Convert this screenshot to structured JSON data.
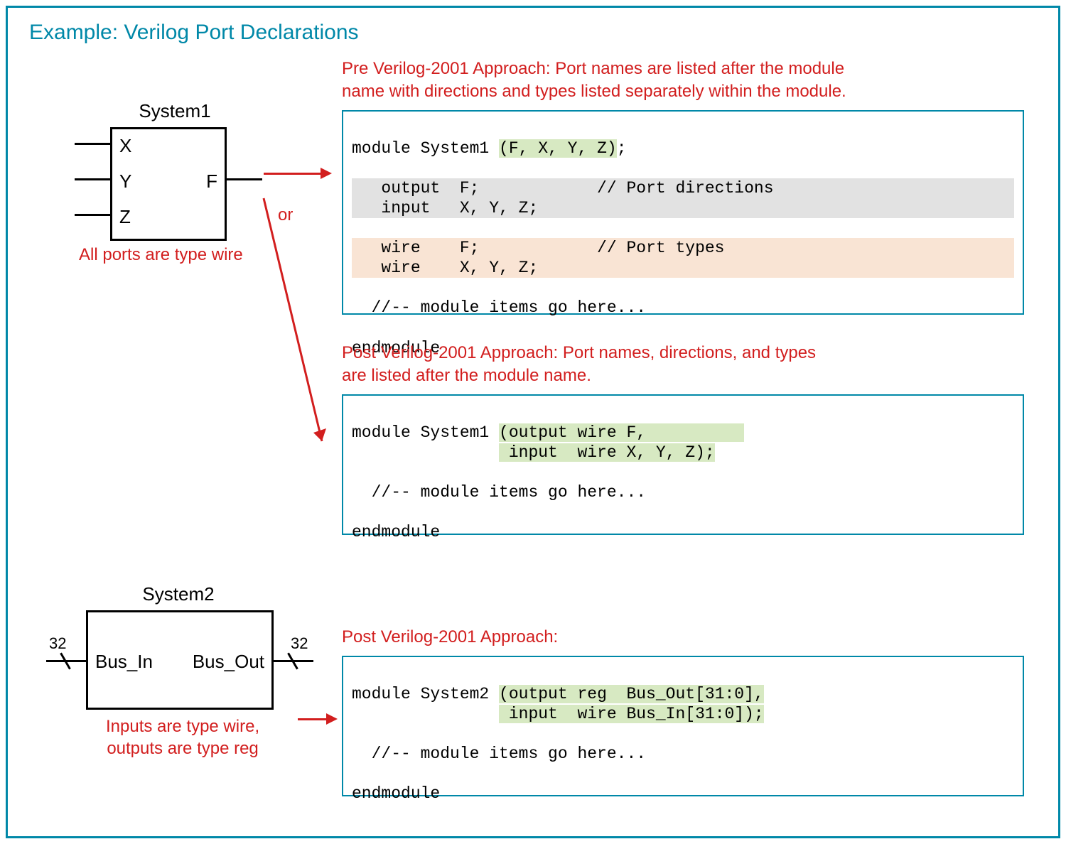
{
  "title": "Example: Verilog Port Declarations",
  "system1": {
    "name": "System1",
    "ports": {
      "in1": "X",
      "in2": "Y",
      "in3": "Z",
      "out": "F"
    },
    "caption": "All ports are type wire"
  },
  "or_label": "or",
  "pre2001": {
    "heading": "Pre Verilog-2001 Approach: Port names are listed after the module\nname with directions and types listed separately within the module.",
    "code_l1a": "module System1 ",
    "code_l1b": "(F, X, Y, Z)",
    "code_l1c": ";",
    "code_dir1": "   output  F;            // Port directions",
    "code_dir2": "   input   X, Y, Z;                         ",
    "code_typ1": "   wire    F;            // Port types     ",
    "code_typ2": "   wire    X, Y, Z;                        ",
    "code_items": "  //-- module items go here...",
    "code_end": "endmodule"
  },
  "post2001_a": {
    "heading": "Post Verilog-2001 Approach: Port names, directions, and types\nare listed after the module name.",
    "code_l1a": "module System1 ",
    "code_l1b": "(output wire F,          ",
    "code_l2b": " input  wire X, Y, Z);",
    "code_items": "  //-- module items go here...",
    "code_end": "endmodule"
  },
  "system2": {
    "name": "System2",
    "port_in": "Bus_In",
    "port_out": "Bus_Out",
    "width": "32",
    "caption_l1": "Inputs are type wire,",
    "caption_l2": "outputs are type reg"
  },
  "post2001_b": {
    "heading": "Post Verilog-2001 Approach:",
    "code_l1a": "module System2 ",
    "code_l1b": "(output reg  Bus_Out[31:0],",
    "code_l2b": " input  wire Bus_In[31:0]);",
    "code_items": "  //-- module items go here...",
    "code_end": "endmodule"
  }
}
